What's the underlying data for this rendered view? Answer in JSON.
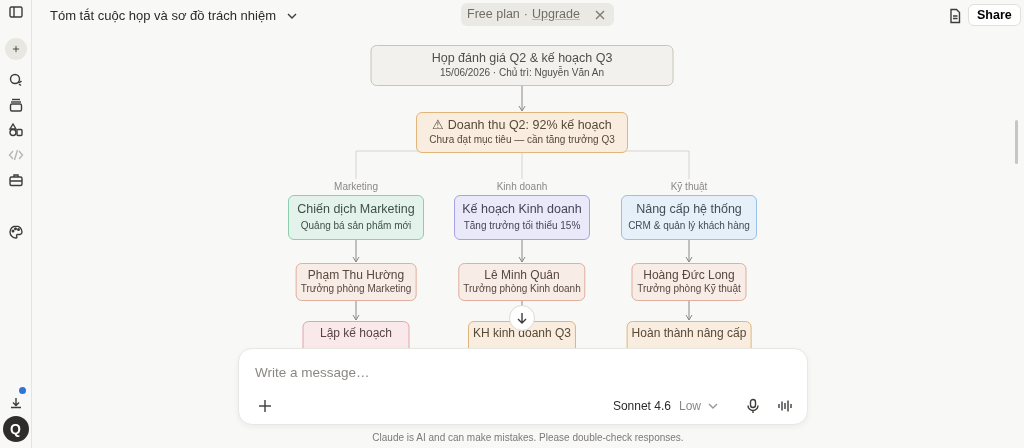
{
  "header": {
    "title": "Tóm tắt cuộc họp và sơ đồ trách nhiệm",
    "plan": "Free plan",
    "separator": "·",
    "upgrade": "Upgrade",
    "share": "Share"
  },
  "sidebar": {
    "avatar": "Q",
    "download_badge": true
  },
  "diagram": {
    "root": {
      "title": "Họp đánh giá Q2 & kế hoạch Q3",
      "subtitle": "15/06/2026 · Chủ trì: Nguyễn Văn An",
      "color": "#c9c4b8"
    },
    "alert": {
      "title": "⚠ Doanh thu Q2: 92% kế hoạch",
      "subtitle": "Chưa đạt mục tiêu — cần tăng trưởng Q3",
      "color": "#e2b57a"
    },
    "branches": [
      {
        "label": "Marketing",
        "goal": {
          "title": "Chiến dịch Marketing",
          "subtitle": "Quảng bá sản phẩm mới",
          "color": "#8ccfae"
        },
        "owner": {
          "title": "Phạm Thu Hường",
          "subtitle": "Trưởng phòng Marketing",
          "color": "#e0ae9c"
        },
        "task": {
          "title": "Lập kế hoạch",
          "color": "#e4a3ab"
        }
      },
      {
        "label": "Kinh doanh",
        "goal": {
          "title": "Kế hoạch Kinh doanh",
          "subtitle": "Tăng trưởng tối thiểu 15%",
          "color": "#a7a2e6"
        },
        "owner": {
          "title": "Lê Minh Quân",
          "subtitle": "Trưởng phòng Kinh doanh",
          "color": "#e0ae9c"
        },
        "task": {
          "title": "KH kinh doanh Q3",
          "color": "#e2b57a"
        }
      },
      {
        "label": "Kỹ thuật",
        "goal": {
          "title": "Nâng cấp hệ thống",
          "subtitle": "CRM & quản lý khách hàng",
          "color": "#98c1e8"
        },
        "owner": {
          "title": "Hoàng Đức Long",
          "subtitle": "Trưởng phòng Kỹ thuật",
          "color": "#e0ae9c"
        },
        "task": {
          "title": "Hoàn thành nâng cấp",
          "color": "#e2b57a"
        }
      }
    ]
  },
  "composer": {
    "placeholder": "Write a message…",
    "model": "Sonnet 4.6",
    "effort": "Low"
  },
  "disclaimer": "Claude is AI and can make mistakes. Please double-check responses."
}
